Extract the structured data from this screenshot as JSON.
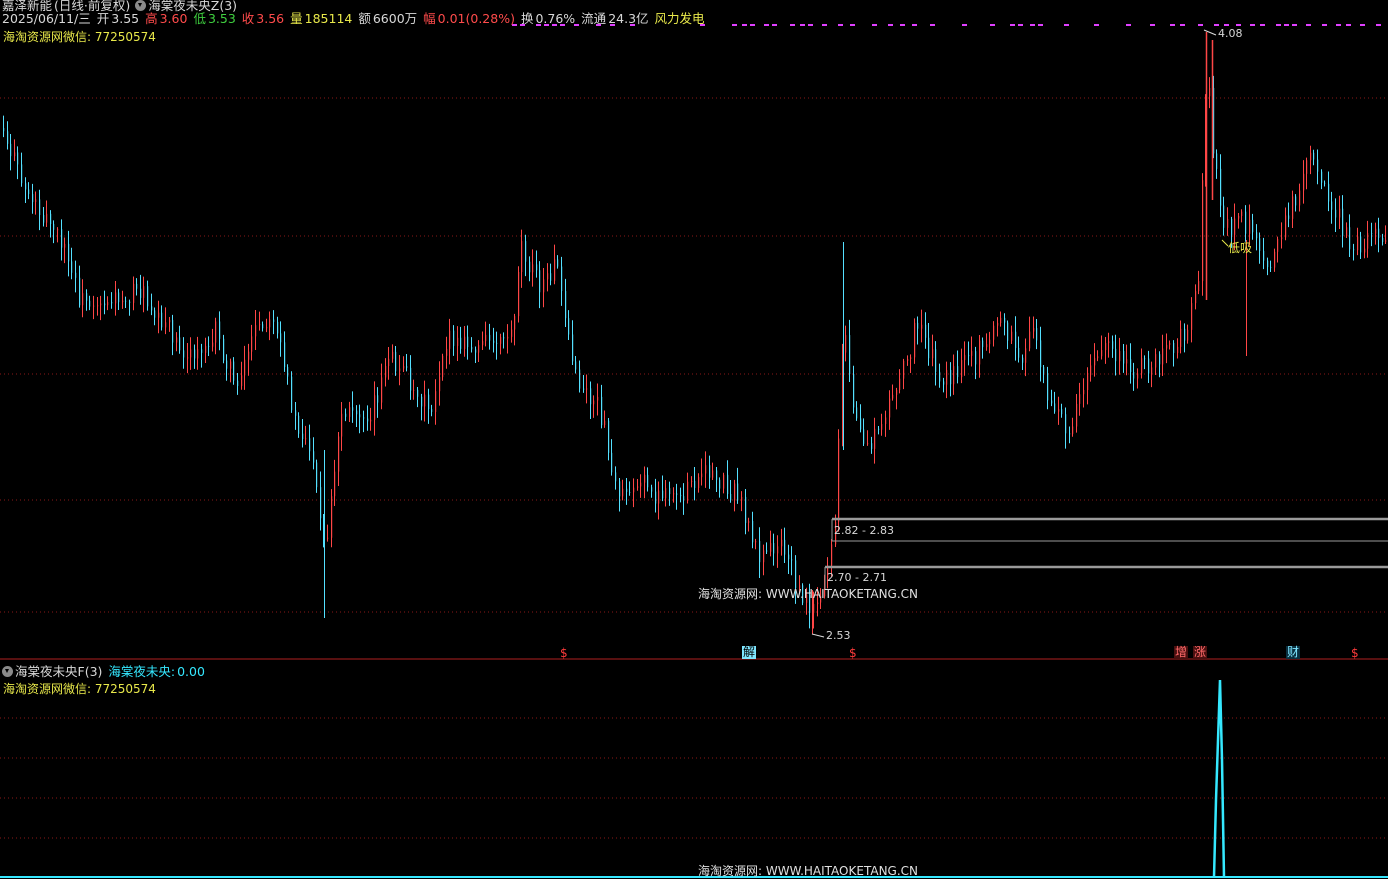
{
  "header": {
    "stock_name": "嘉泽新能",
    "period": "(日线·前复权)",
    "indicator_main": "海棠夜未央Z(3)",
    "date": "2025/06/11/三",
    "open_label": "开",
    "open": "3.55",
    "high_label": "高",
    "high": "3.60",
    "low_label": "低",
    "low": "3.53",
    "close_label": "收",
    "close": "3.56",
    "volume_label": "量",
    "volume": "185114",
    "amount_label": "额",
    "amount": "6600万",
    "change_label": "幅",
    "change": "0.01(0.28%)",
    "turnover_label": "换",
    "turnover": "0.76%",
    "float_label": "流通",
    "float_cap": "24.3亿",
    "sector": "风力发电"
  },
  "main_panel": {
    "contact_text": "海淘资源网微信: 77250574",
    "watermark": "海淘资源网: WWW.HAITAOKETANG.CN",
    "high_marker": "4.08",
    "low_marker": "2.53",
    "zone_upper": "2.82 - 2.83",
    "zone_lower": "2.70 - 2.71",
    "buy_label": "低吸",
    "colors": {
      "up": "#ff4646",
      "down": "#54e0ff",
      "grid": "#8a1818",
      "purple": "#e040ff",
      "zone": "#9a9a9a"
    }
  },
  "signals": [
    {
      "text": "$",
      "color": "#ff3b3b"
    },
    {
      "text": "解",
      "color": "#7fe6ff"
    },
    {
      "text": "$",
      "color": "#ff3b3b"
    },
    {
      "text": "增",
      "color": "#ff5a5a"
    },
    {
      "text": "涨",
      "color": "#ff5a5a"
    },
    {
      "text": "财",
      "color": "#7fe6ff"
    },
    {
      "text": "$",
      "color": "#ff3b3b"
    }
  ],
  "sub_panel": {
    "indicator": "海棠夜未央F(3)",
    "series_label": "海棠夜未央:",
    "series_value": "0.00",
    "contact_text": "海淘资源网微信: 77250574",
    "watermark": "海淘资源网: WWW.HAITAOKETANG.CN"
  },
  "icons": {
    "menu": "circle-dropdown-icon"
  }
}
